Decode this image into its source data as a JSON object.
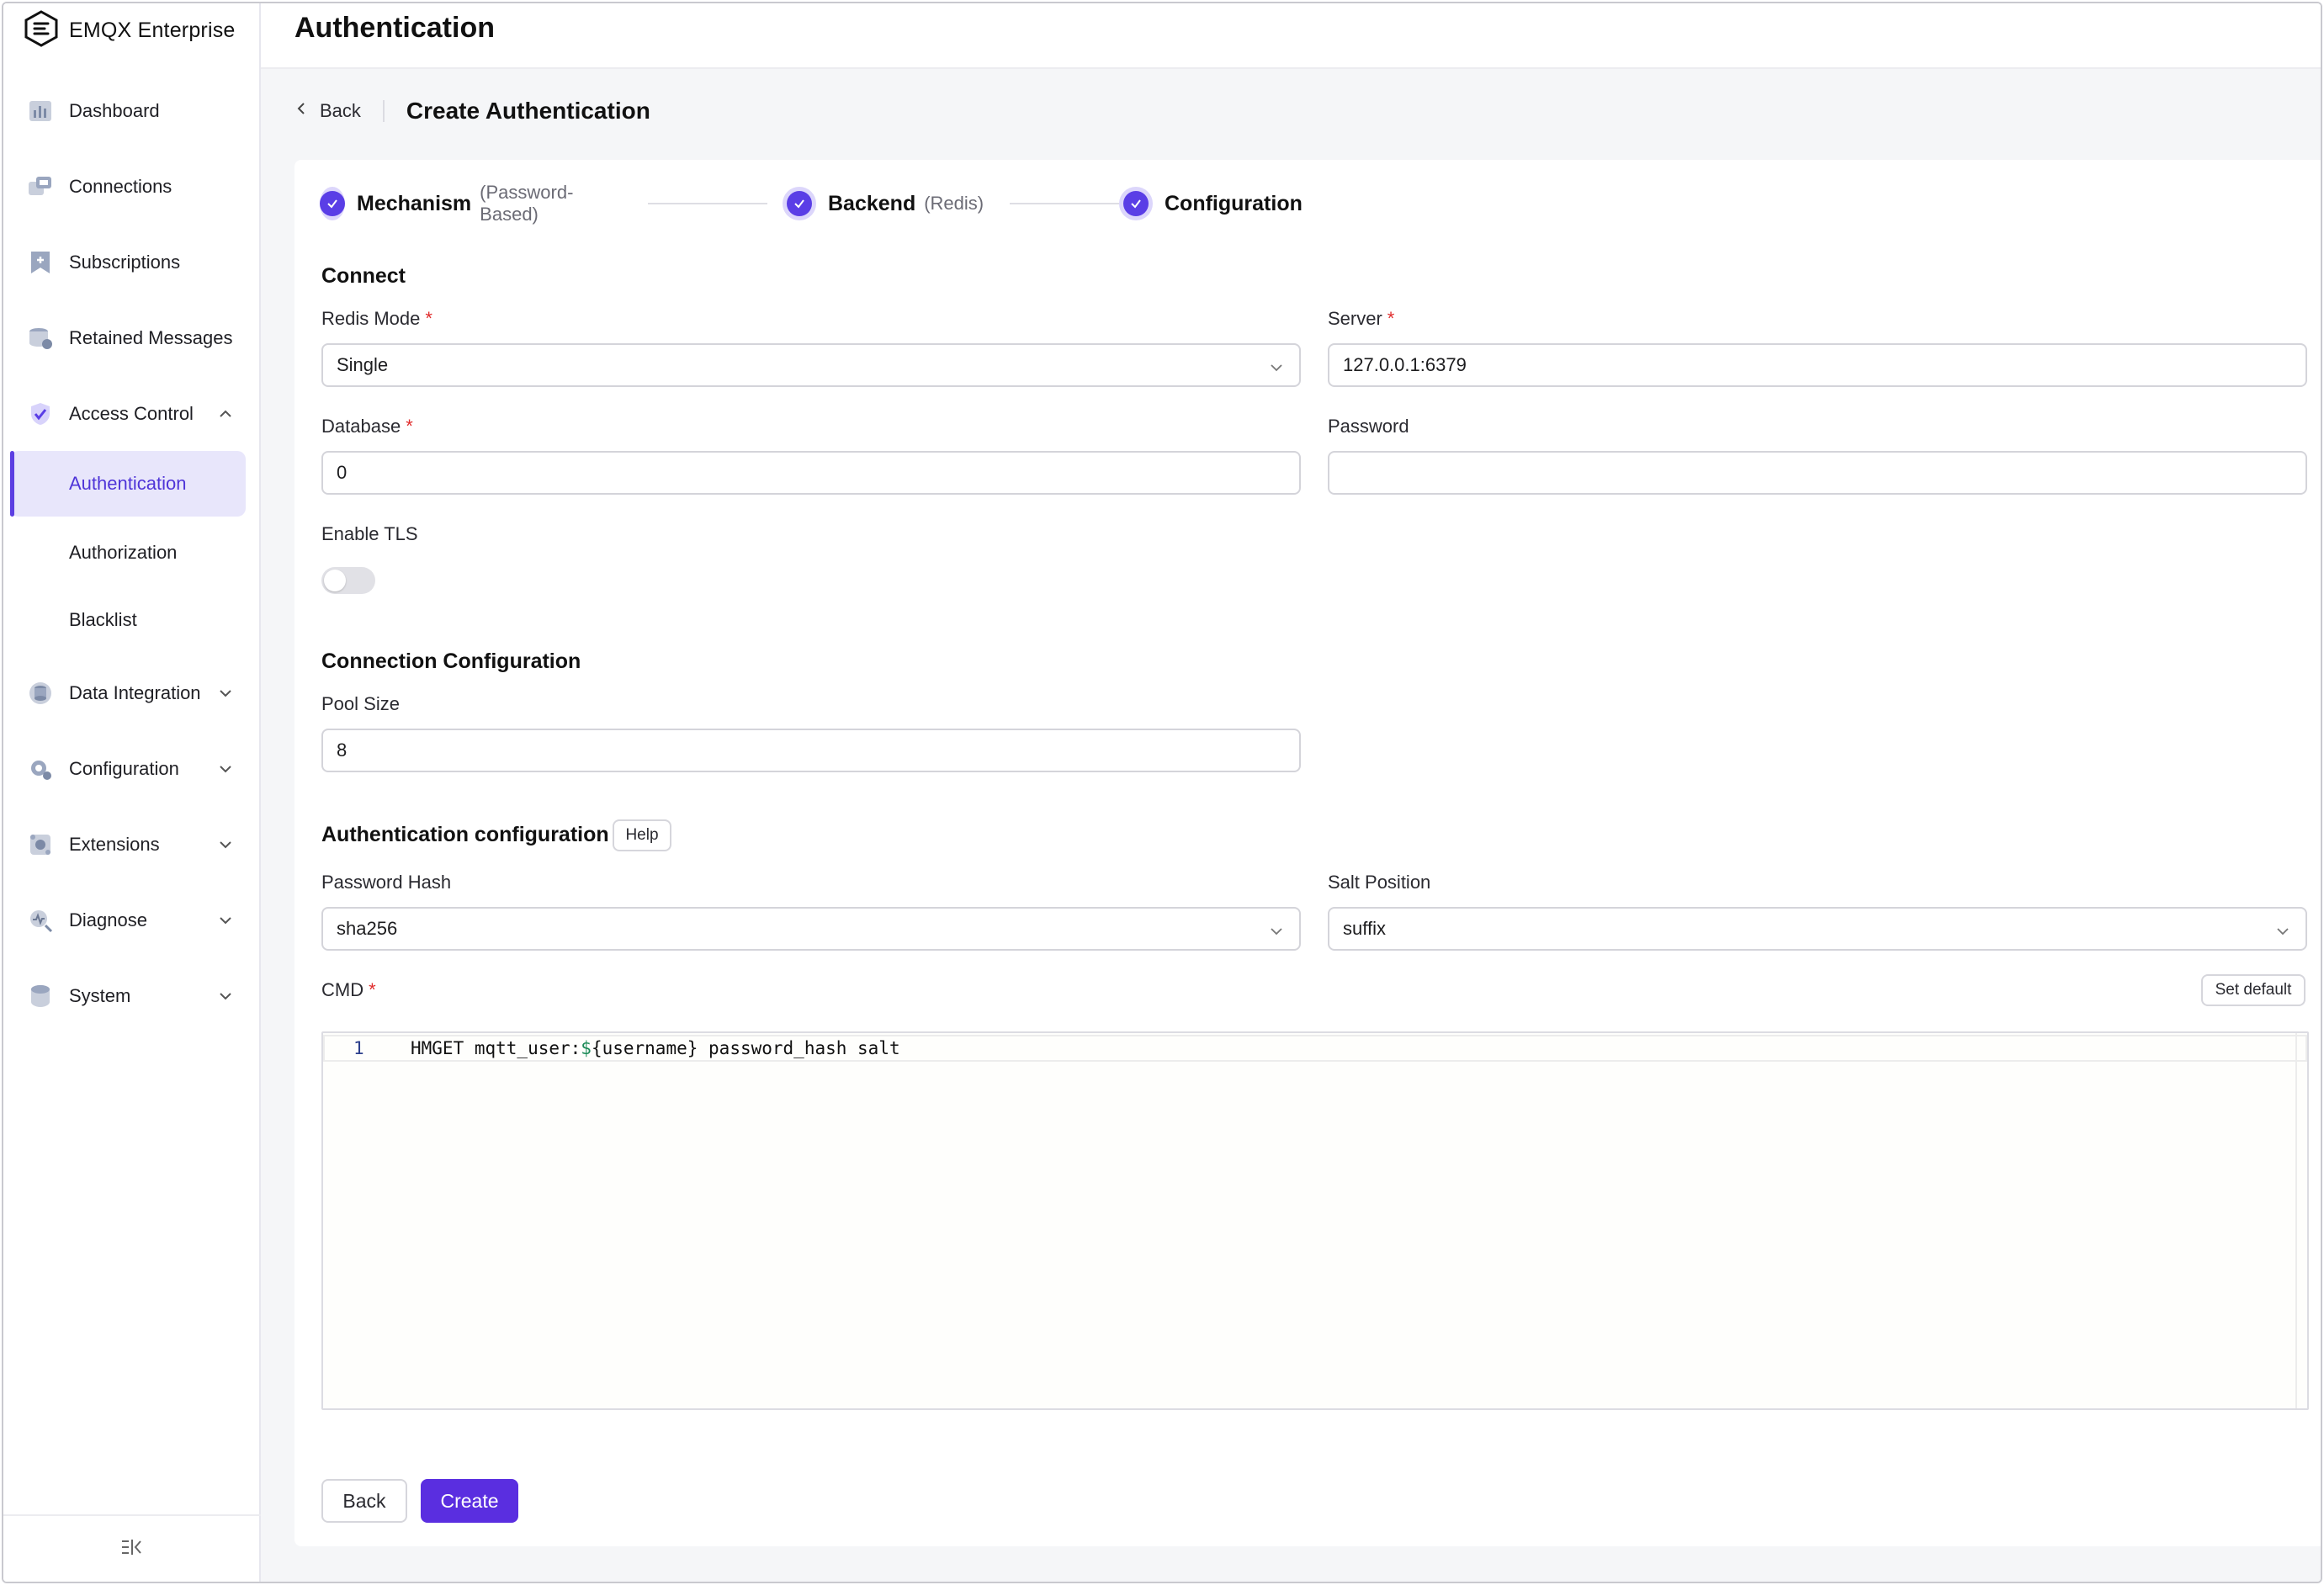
{
  "app": {
    "name": "EMQX Enterprise"
  },
  "sidebar": {
    "items": [
      {
        "label": "Dashboard",
        "icon": "dashboard-icon"
      },
      {
        "label": "Connections",
        "icon": "connections-icon"
      },
      {
        "label": "Subscriptions",
        "icon": "subscriptions-icon"
      },
      {
        "label": "Retained Messages",
        "icon": "retained-messages-icon"
      },
      {
        "label": "Access Control",
        "icon": "access-control-icon",
        "expanded": true
      },
      {
        "label": "Data Integration",
        "icon": "data-integration-icon"
      },
      {
        "label": "Configuration",
        "icon": "configuration-icon"
      },
      {
        "label": "Extensions",
        "icon": "extensions-icon"
      },
      {
        "label": "Diagnose",
        "icon": "diagnose-icon"
      },
      {
        "label": "System",
        "icon": "system-icon"
      }
    ],
    "sub_items": [
      {
        "label": "Authentication",
        "active": true
      },
      {
        "label": "Authorization"
      },
      {
        "label": "Blacklist"
      }
    ]
  },
  "header": {
    "title": "Authentication"
  },
  "breadcrumb": {
    "back_label": "Back",
    "page_title": "Create Authentication"
  },
  "steps": [
    {
      "name": "Mechanism",
      "desc": "(Password-Based)"
    },
    {
      "name": "Backend",
      "desc": "(Redis)"
    },
    {
      "name": "Configuration",
      "desc": ""
    }
  ],
  "connect": {
    "title": "Connect",
    "redis_mode": {
      "label": "Redis Mode",
      "value": "Single"
    },
    "server": {
      "label": "Server",
      "value": "127.0.0.1:6379"
    },
    "database": {
      "label": "Database",
      "value": "0"
    },
    "password": {
      "label": "Password",
      "value": ""
    },
    "tls": {
      "label": "Enable TLS",
      "enabled": false
    }
  },
  "connection_config": {
    "title": "Connection Configuration",
    "pool_size": {
      "label": "Pool Size",
      "value": "8"
    }
  },
  "auth_config": {
    "title": "Authentication configuration",
    "help_label": "Help",
    "password_hash": {
      "label": "Password Hash",
      "value": "sha256"
    },
    "salt_position": {
      "label": "Salt Position",
      "value": "suffix"
    },
    "cmd": {
      "label": "CMD",
      "set_default_label": "Set default",
      "line_number": "1",
      "code_prefix": "HMGET mqtt_user:",
      "code_var": "$",
      "code_suffix": "{username} password_hash salt"
    }
  },
  "actions": {
    "back_label": "Back",
    "create_label": "Create"
  },
  "colors": {
    "accent": "#5a2ee0",
    "active_bg": "#e8e6fb",
    "required": "#e02d2d"
  }
}
